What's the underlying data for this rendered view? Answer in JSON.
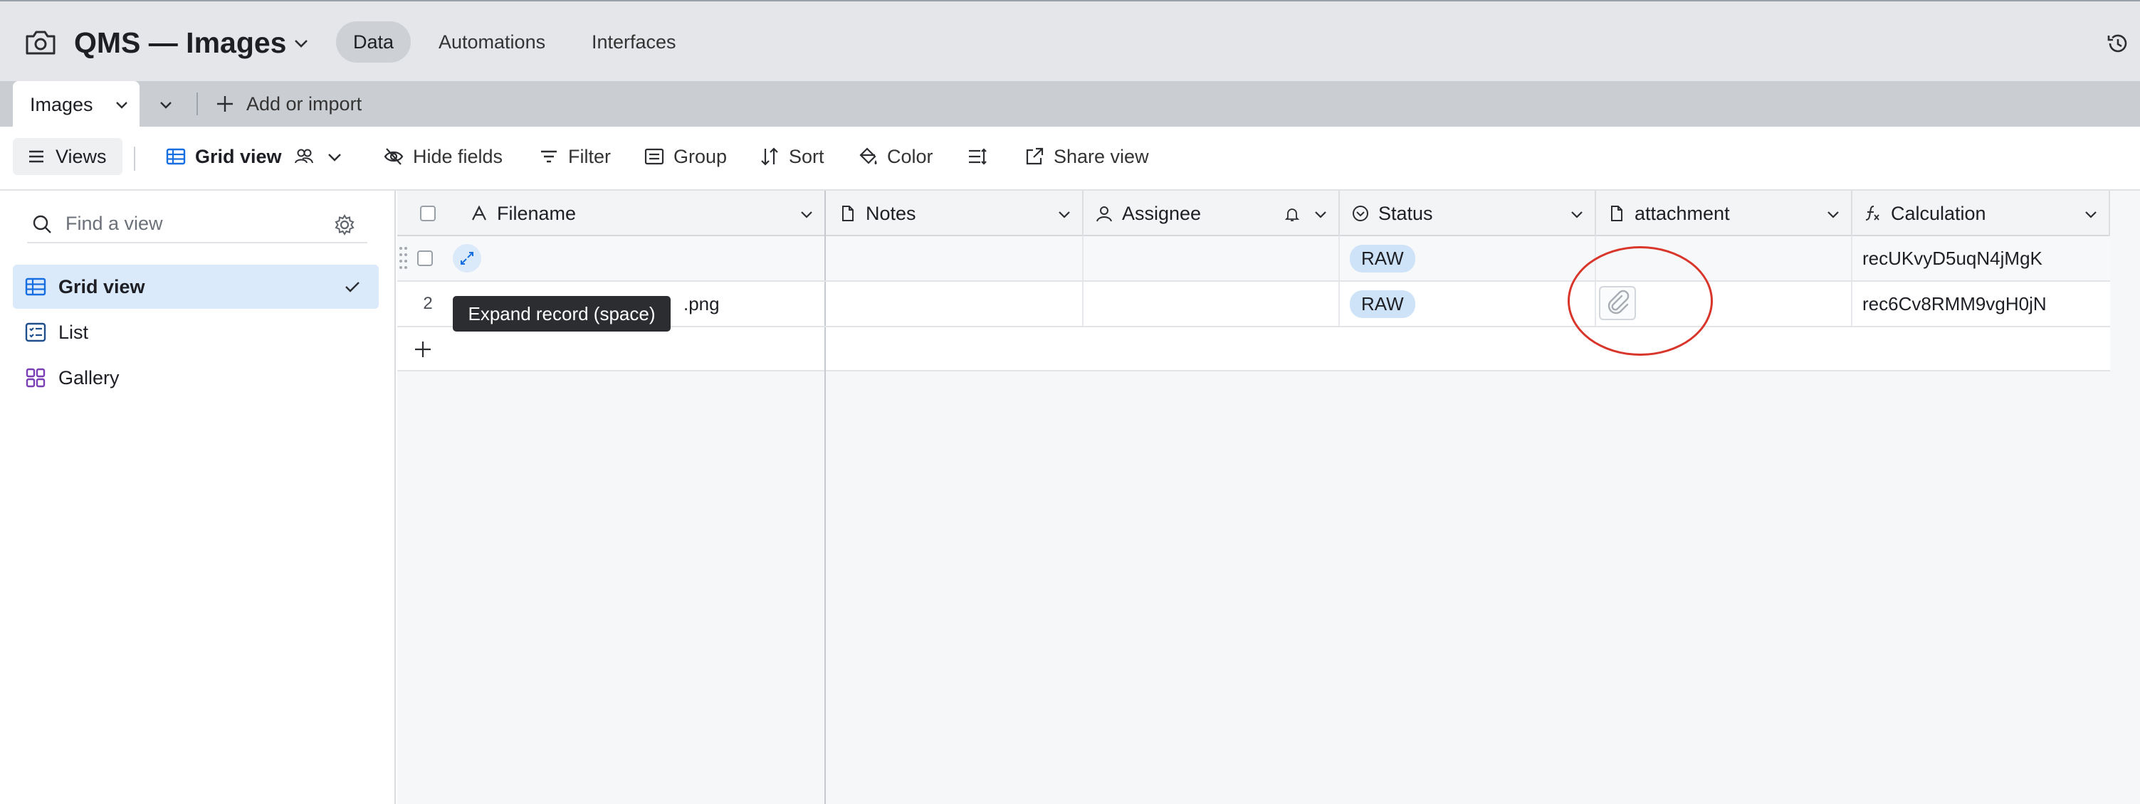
{
  "app": {
    "title": "QMS — Images",
    "nav_tabs": [
      "Data",
      "Automations",
      "Interfaces"
    ]
  },
  "tabs": {
    "table_name": "Images",
    "add_import": "Add or import"
  },
  "toolbar": {
    "views": "Views",
    "grid_view": "Grid view",
    "hide_fields": "Hide fields",
    "filter": "Filter",
    "group": "Group",
    "sort": "Sort",
    "color": "Color",
    "share_view": "Share view"
  },
  "sidebar": {
    "search_placeholder": "Find a view",
    "items": [
      {
        "label": "Grid view",
        "icon": "grid-icon",
        "active": true
      },
      {
        "label": "List",
        "icon": "list-icon",
        "active": false
      },
      {
        "label": "Gallery",
        "icon": "gallery-icon",
        "active": false
      }
    ]
  },
  "grid": {
    "columns": [
      "Filename",
      "Notes",
      "Assignee",
      "Status",
      "attachment",
      "Calculation"
    ],
    "rows": [
      {
        "number": "",
        "filename": "",
        "notes": "",
        "assignee": "",
        "status": "RAW",
        "calculation": "recUKvyD5uqN4jMgK"
      },
      {
        "number": "2",
        "filename": ".png",
        "notes": "",
        "assignee": "",
        "status": "RAW",
        "calculation": "rec6Cv8RMM9vgH0jN"
      }
    ],
    "tooltip": "Expand record (space)"
  },
  "colors": {
    "accent_blue": "#166ee1",
    "status_pill": "#cfe3f8",
    "annotation_red": "#d9362b"
  }
}
